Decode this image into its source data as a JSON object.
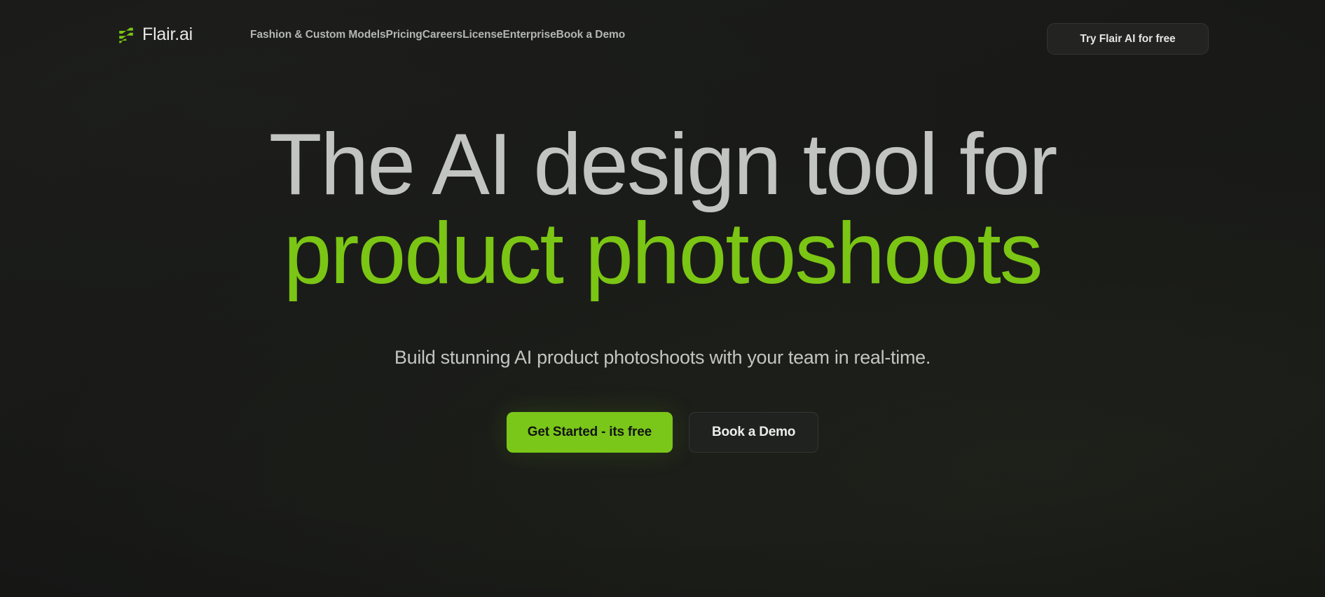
{
  "brand": {
    "name": "Flair.ai",
    "logo_icon": "flair-f-logo-icon",
    "accent_color": "#7bc514"
  },
  "header": {
    "nav_items": [
      {
        "label": "Fashion & Custom Models",
        "name": "fashion-custom-models"
      },
      {
        "label": "Pricing",
        "name": "pricing"
      },
      {
        "label": "Careers",
        "name": "careers"
      },
      {
        "label": "License",
        "name": "license"
      },
      {
        "label": "Enterprise",
        "name": "enterprise"
      },
      {
        "label": "Book a Demo",
        "name": "book-a-demo"
      }
    ],
    "cta_label": "Try Flair AI  for free"
  },
  "hero": {
    "headline_line1": "The AI design tool for",
    "headline_line2": "product photoshoots",
    "subtitle": "Build stunning AI product photoshoots with your team in real-time.",
    "primary_cta": "Get Started - its free",
    "secondary_cta": "Book a Demo"
  },
  "colors": {
    "background": "#1a1b19",
    "accent_green": "#7bc514",
    "button_green": "#7ac71a",
    "heading_gray": "#c2c4c1",
    "nav_gray": "#b4b6b3"
  }
}
